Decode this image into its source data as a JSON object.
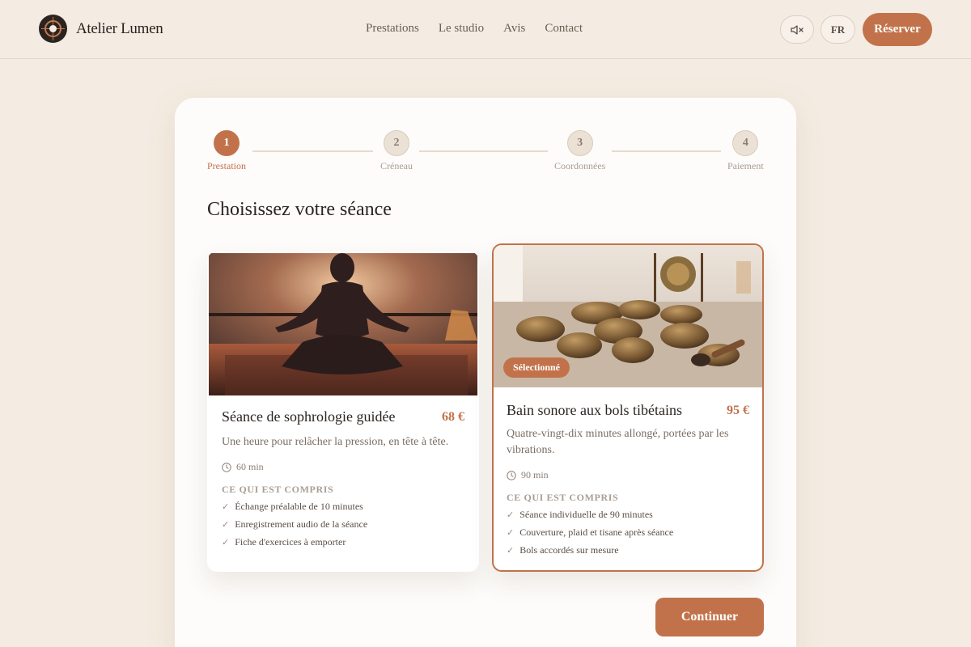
{
  "brand": {
    "name": "Atelier Lumen",
    "logo_icon": "sun-target-logo"
  },
  "nav": {
    "items": [
      {
        "label": "Prestations"
      },
      {
        "label": "Le studio"
      },
      {
        "label": "Avis"
      },
      {
        "label": "Contact"
      }
    ]
  },
  "actions": {
    "mute_icon": "speaker-muted-icon",
    "lang_label": "FR",
    "reserve_label": "Réserver"
  },
  "stepper": {
    "steps": [
      {
        "number": "1",
        "label": "Prestation",
        "active": true
      },
      {
        "number": "2",
        "label": "Créneau",
        "active": false
      },
      {
        "number": "3",
        "label": "Coordonnées",
        "active": false
      },
      {
        "number": "4",
        "label": "Paiement",
        "active": false
      }
    ]
  },
  "page_title": "Choisissez votre séance",
  "services": [
    {
      "name": "Séance de sophrologie guidée",
      "price": "68 €",
      "description": "Une heure pour relâcher la pression, en tête à tête.",
      "duration": "60 min",
      "included_title": "CE QUI EST COMPRIS",
      "included": [
        "Échange préalable de 10 minutes",
        "Enregistrement audio de la séance",
        "Fiche d'exercices à emporter"
      ],
      "selected": false,
      "image": "meditation-silhouette-photo"
    },
    {
      "name": "Bain sonore aux bols tibétains",
      "price": "95 €",
      "description": "Quatre-vingt-dix minutes allongé, portées par les vibrations.",
      "duration": "90 min",
      "included_title": "CE QUI EST COMPRIS",
      "included": [
        "Séance individuelle de 90 minutes",
        "Couverture, plaid et tisane après séance",
        "Bols accordés sur mesure"
      ],
      "selected": true,
      "badge": "Sélectionné",
      "image": "tibetan-singing-bowls-photo"
    }
  ],
  "continue_label": "Continuer",
  "colors": {
    "accent": "#c2724a",
    "background": "#f4ece2",
    "panel": "#fdfcfa"
  }
}
